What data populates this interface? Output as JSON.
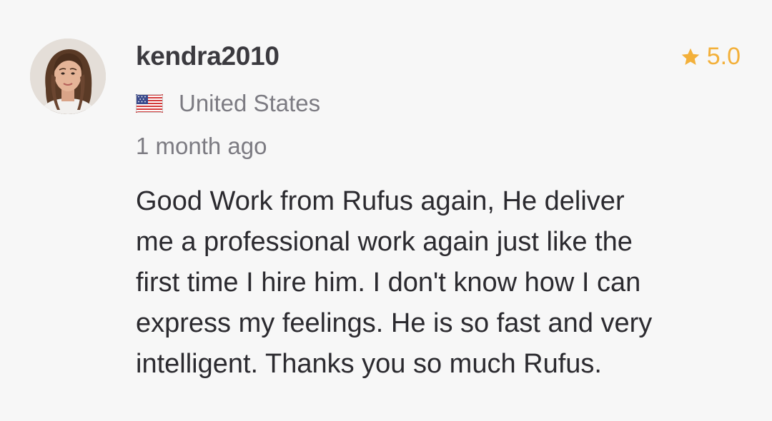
{
  "review": {
    "author": {
      "avatar_icon": "user-avatar-photo",
      "username": "kendra2010",
      "country": "United States",
      "flag_icon": "us-flag-icon"
    },
    "rating": {
      "icon": "star-icon",
      "value": "5.0",
      "color": "#f3b03a"
    },
    "time_ago": "1 month ago",
    "text_lines": [
      "Good Work from Rufus again, He deliver",
      "me a professional work again just like the",
      "first time I hire him. I don't know how I can",
      "express my feelings. He is so fast and very",
      "intelligent. Thanks you so much Rufus."
    ]
  }
}
